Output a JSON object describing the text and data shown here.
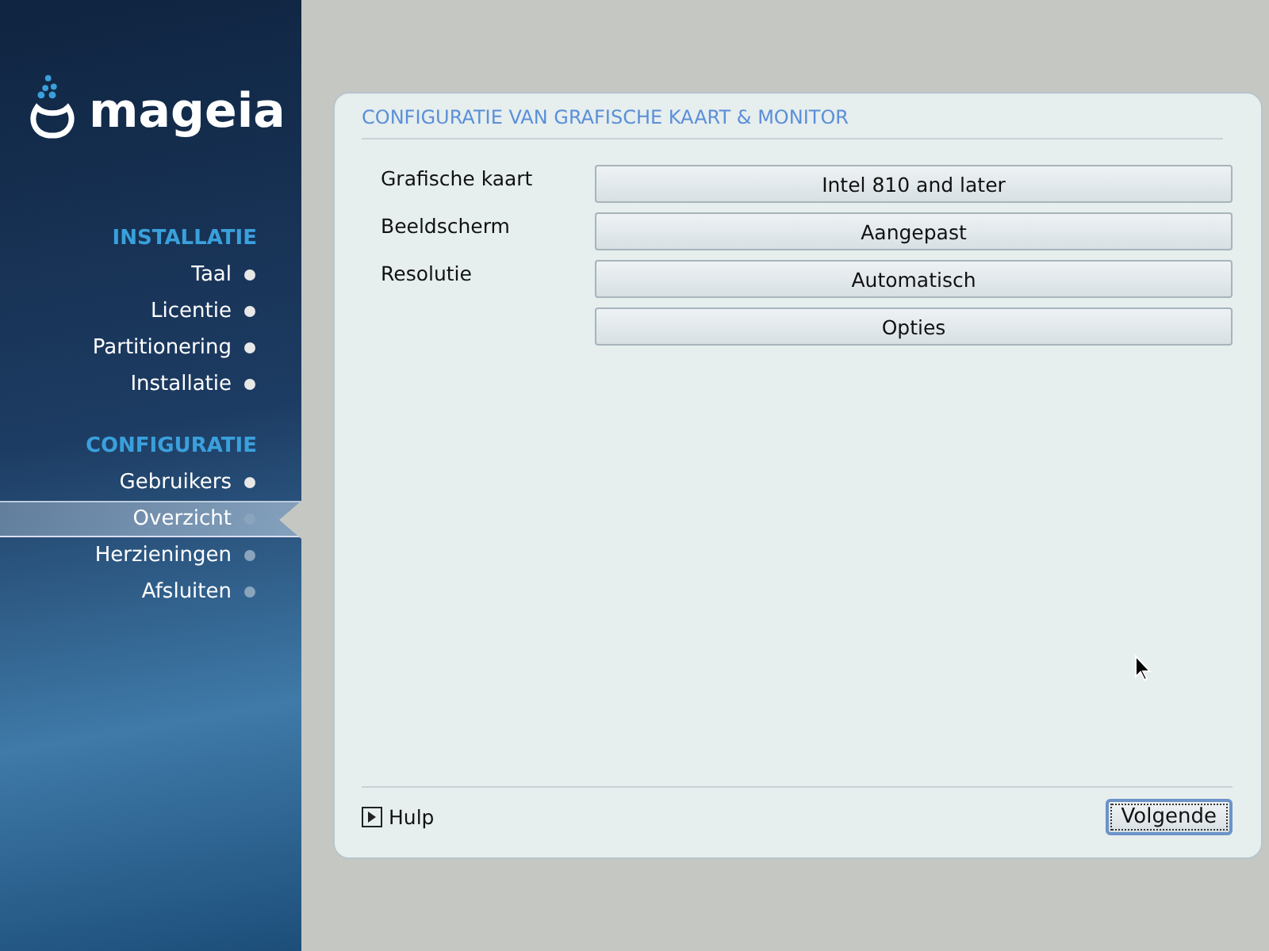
{
  "logo": {
    "text": "mageia"
  },
  "sidebar": {
    "sections": [
      {
        "title": "INSTALLATIE",
        "items": [
          {
            "label": "Taal",
            "done": true,
            "selected": false
          },
          {
            "label": "Licentie",
            "done": true,
            "selected": false
          },
          {
            "label": "Partitionering",
            "done": true,
            "selected": false
          },
          {
            "label": "Installatie",
            "done": true,
            "selected": false
          }
        ]
      },
      {
        "title": "CONFIGURATIE",
        "items": [
          {
            "label": "Gebruikers",
            "done": true,
            "selected": false
          },
          {
            "label": "Overzicht",
            "done": false,
            "selected": true
          },
          {
            "label": "Herzieningen",
            "done": false,
            "selected": false
          },
          {
            "label": "Afsluiten",
            "done": false,
            "selected": false
          }
        ]
      }
    ]
  },
  "panel": {
    "title": "CONFIGURATIE VAN GRAFISCHE KAART & MONITOR",
    "rows": [
      {
        "label": "Grafische kaart",
        "value": "Intel 810 and later"
      },
      {
        "label": "Beeldscherm",
        "value": "Aangepast"
      },
      {
        "label": "Resolutie",
        "value": "Automatisch"
      },
      {
        "value": "Opties"
      }
    ],
    "help": "Hulp",
    "next": "Volgende"
  }
}
